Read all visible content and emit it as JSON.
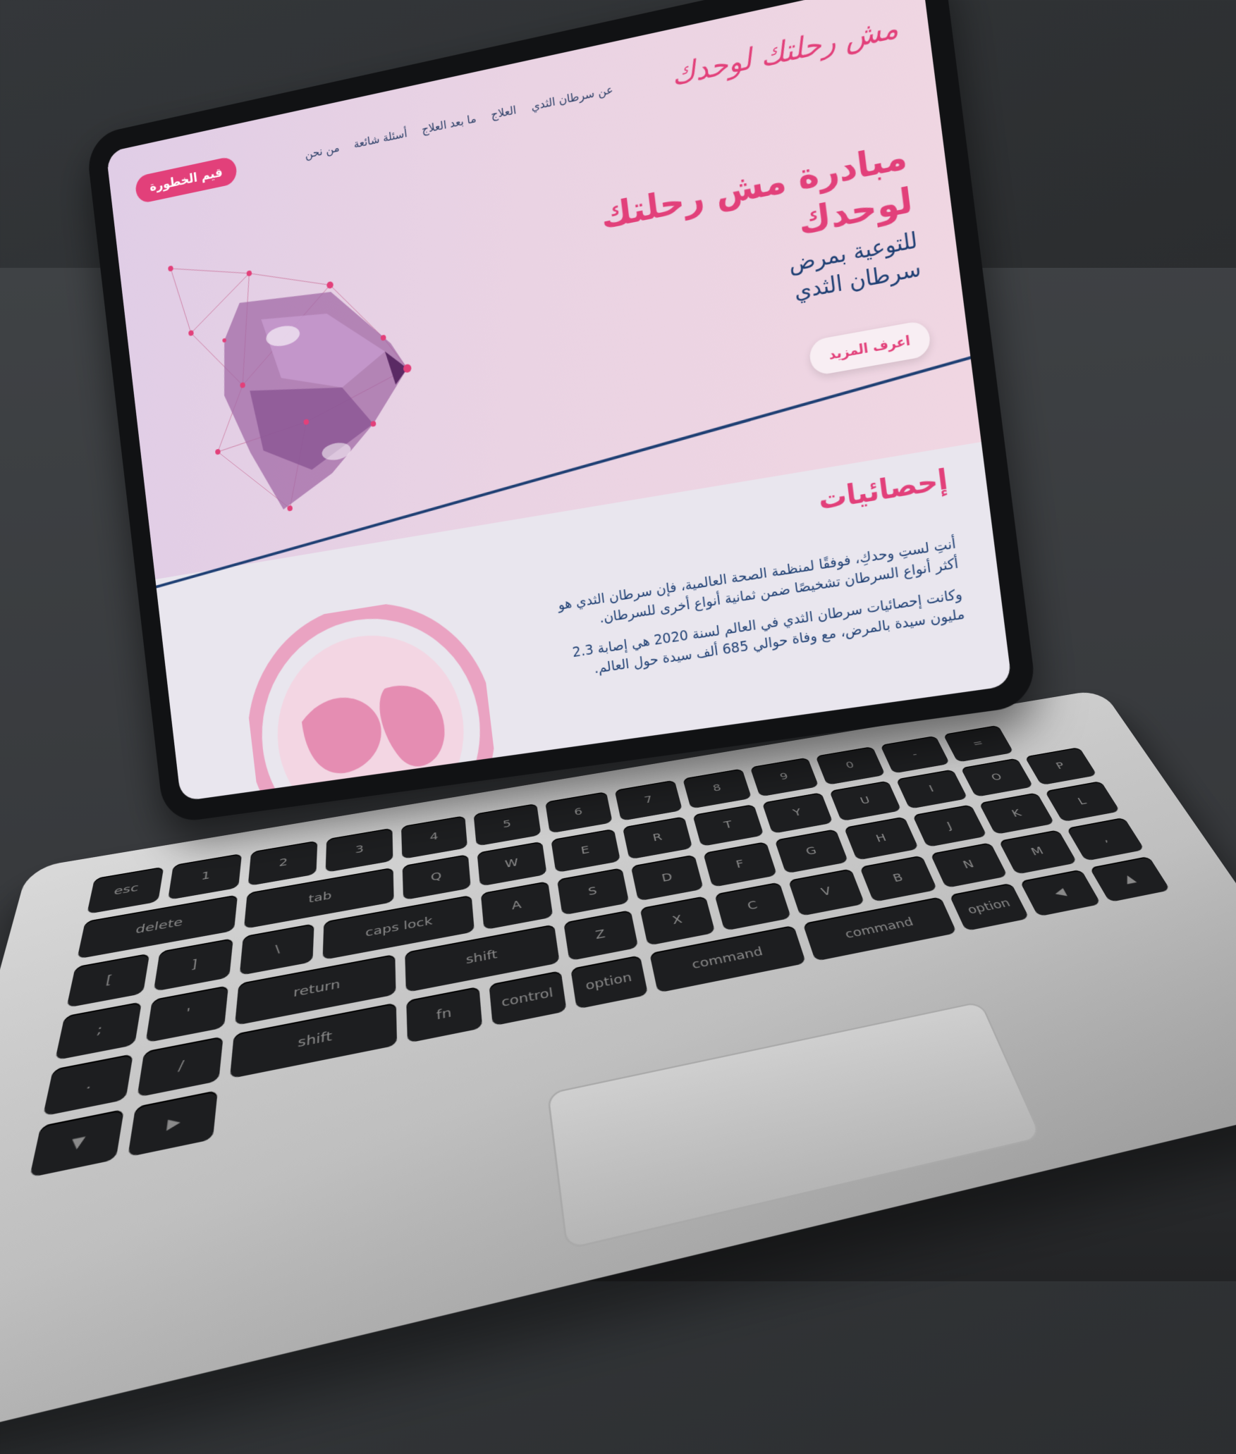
{
  "site": {
    "logo_text": "مش رحلتك لوحدك",
    "nav": {
      "items": [
        "عن سرطان الثدي",
        "العلاج",
        "ما بعد العلاج",
        "أسئلة شائعة",
        "من نحن"
      ],
      "cta_label": "قيم الخطورة"
    },
    "hero": {
      "headline_line1": "مبادرة مش رحلتك",
      "headline_line2": "لوحدك",
      "subline_line1": "للتوعية بمرض",
      "subline_line2": "سرطان الثدي",
      "button_label": "اعرف المزيد"
    },
    "stats": {
      "title": "إحصائيات",
      "paragraph1": "أنتِ لستِ وحدكِ، فوفقًا لمنظمة الصحة العالمية، فإن سرطان الثدي هو أكثر أنواع السرطان تشخيصًا ضمن ثمانية أنواع أخرى للسرطان.",
      "paragraph2": "وكانت إحصائيات سرطان الثدي في العالم لسنة 2020 هي إصابة 2.3 مليون سيدة بالمرض، مع وفاة حوالي 685 ألف سيدة حول العالم."
    }
  },
  "keyboard": {
    "rows": [
      [
        "esc",
        "1",
        "2",
        "3",
        "4",
        "5",
        "6",
        "7",
        "8",
        "9",
        "0",
        "-",
        "=",
        "delete"
      ],
      [
        "tab",
        "Q",
        "W",
        "E",
        "R",
        "T",
        "Y",
        "U",
        "I",
        "O",
        "P",
        "[",
        "]",
        "\\"
      ],
      [
        "caps lock",
        "A",
        "S",
        "D",
        "F",
        "G",
        "H",
        "J",
        "K",
        "L",
        ";",
        "'",
        "return"
      ],
      [
        "shift",
        "Z",
        "X",
        "C",
        "V",
        "B",
        "N",
        "M",
        ",",
        ".",
        "/",
        "shift"
      ],
      [
        "fn",
        "control",
        "option",
        "command",
        "command",
        "option",
        "◀",
        "▲",
        "▼",
        "▶"
      ]
    ]
  },
  "colors": {
    "accent_pink": "#e2407a",
    "navy": "#1e3f73",
    "hero_bg": "#e6d2e6",
    "device_frame": "#111214"
  },
  "icons": {
    "hero_art": "low-poly-breast-illustration",
    "stats_art": "pink-globe-ribbon-illustration"
  }
}
